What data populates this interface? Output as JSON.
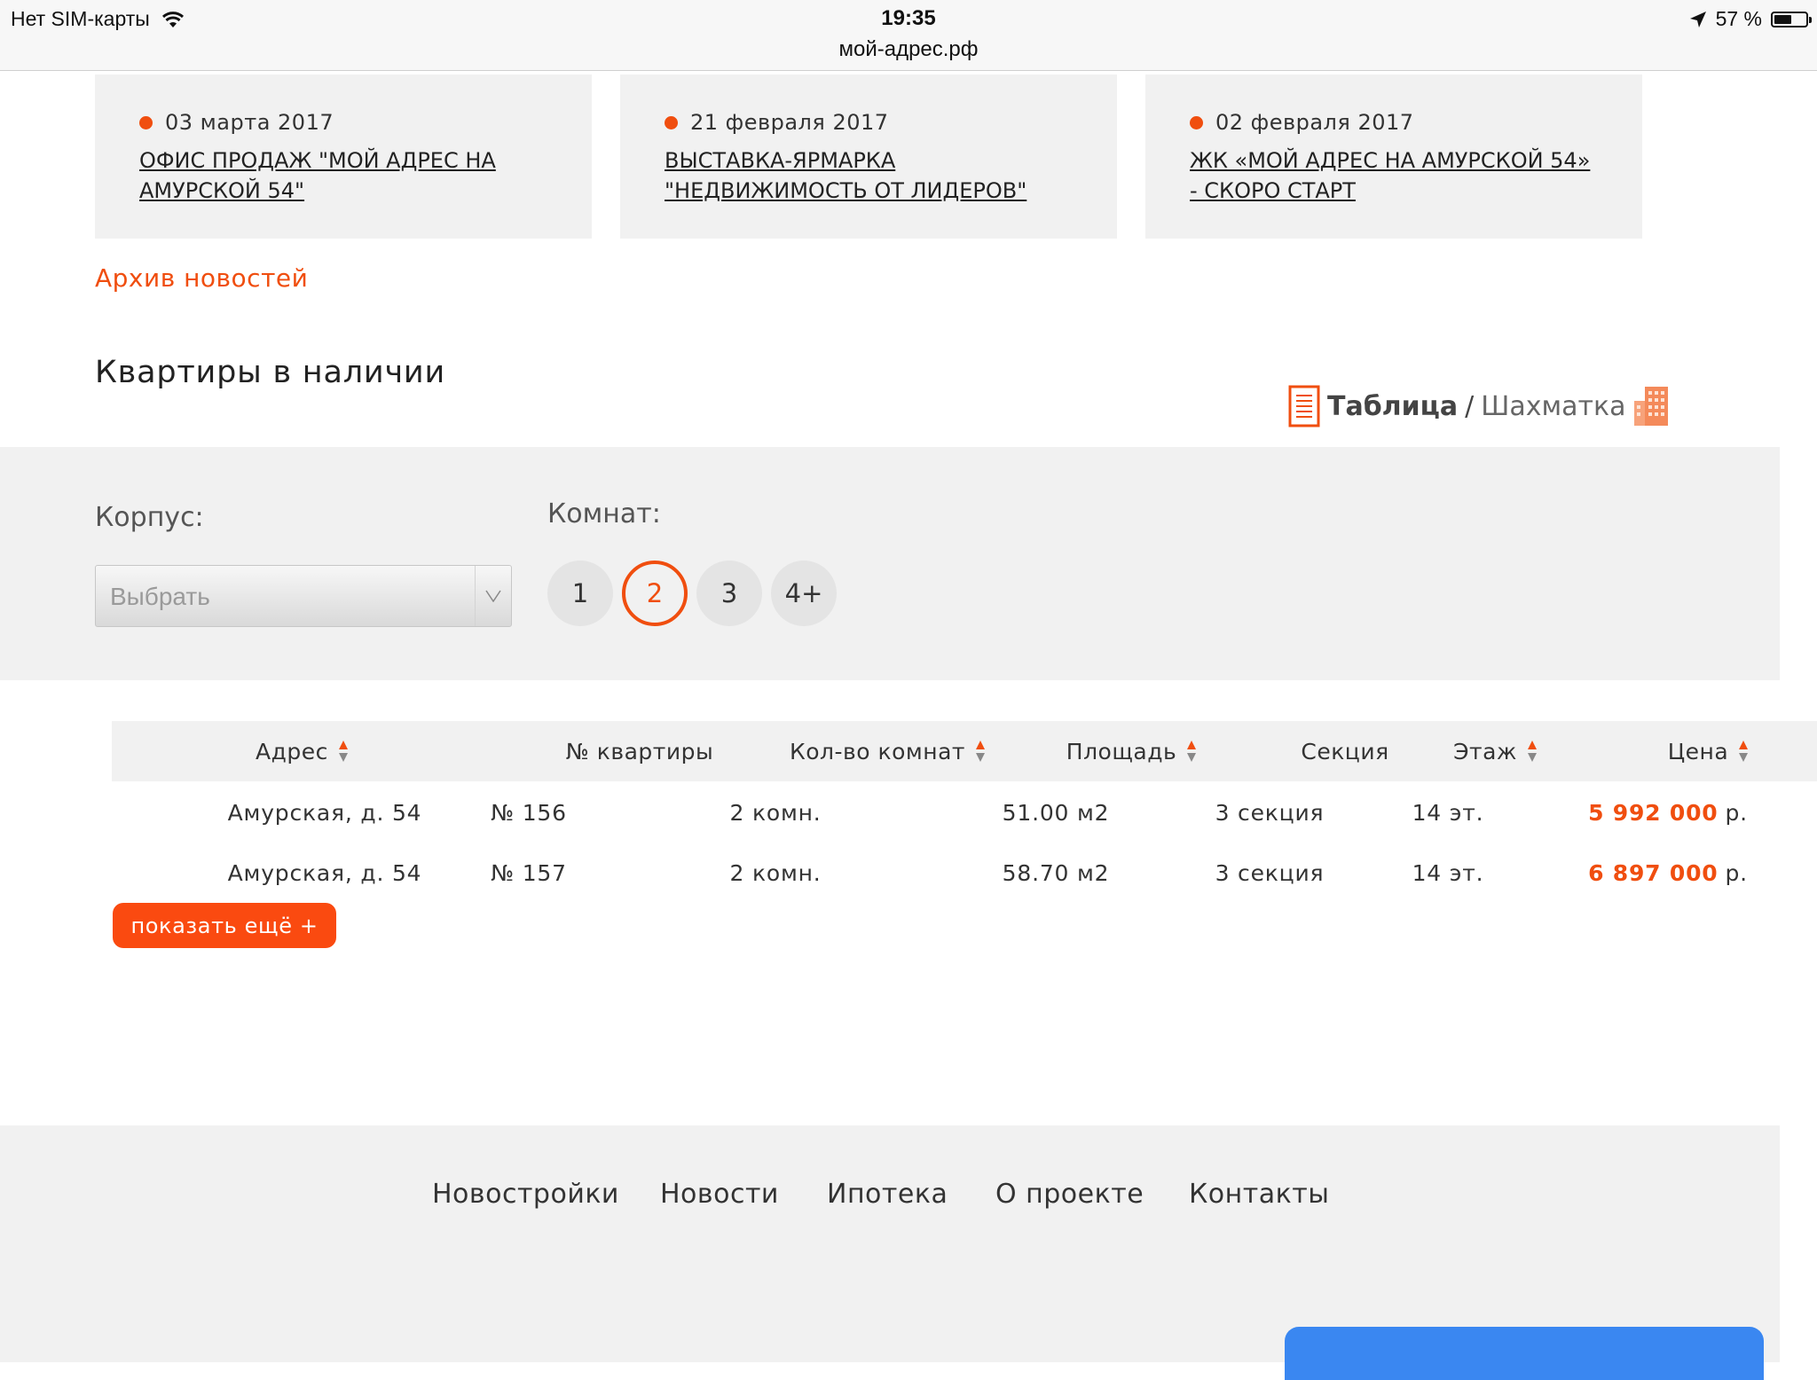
{
  "status_bar": {
    "carrier": "Нет SIM-карты",
    "time": "19:35",
    "url": "мой-адрес.рф",
    "battery_text": "57 %",
    "battery_level": 0.57
  },
  "news": [
    {
      "date": "03 марта 2017",
      "title_line1": "ОФИС ПРОДАЖ \"МОЙ АДРЕС НА",
      "title_line2": "АМУРСКОЙ 54\""
    },
    {
      "date": "21 февраля 2017",
      "title_line1": "ВЫСТАВКА-ЯРМАРКА",
      "title_line2": "\"НЕДВИЖИМОСТЬ ОТ ЛИДЕРОВ\""
    },
    {
      "date": "02 февраля 2017",
      "title_line1": "ЖК «МОЙ АДРЕС НА АМУРСКОЙ 54»",
      "title_line2": "- СКОРО СТАРТ"
    }
  ],
  "archive_link": "Архив новостей",
  "section_title": "Квартиры в наличии",
  "view_toggle": {
    "table": "Таблица",
    "separator": "/",
    "chess": "Шахматка"
  },
  "filters": {
    "korpus_label": "Корпус:",
    "korpus_value": "Выбрать",
    "rooms_label": "Комнат:",
    "rooms": [
      "1",
      "2",
      "3",
      "4+"
    ],
    "rooms_selected": "2"
  },
  "table": {
    "columns": [
      "Адрес",
      "№ квартиры",
      "Кол-во комнат",
      "Площадь",
      "Секция",
      "Этаж",
      "Цена"
    ],
    "rows": [
      {
        "address": "Амурская, д. 54",
        "number": "№ 156",
        "rooms": "2 комн.",
        "area": "51.00 м2",
        "section": "3 секция",
        "floor": "14 эт.",
        "price": "5 992 000",
        "currency": "р."
      },
      {
        "address": "Амурская, д. 54",
        "number": "№ 157",
        "rooms": "2 комн.",
        "area": "58.70 м2",
        "section": "3 секция",
        "floor": "14 эт.",
        "price": "6 897 000",
        "currency": "р."
      }
    ]
  },
  "show_more": "показать ещё +",
  "footer_nav": [
    "Новостройки",
    "Новости",
    "Ипотека",
    "О проекте",
    "Контакты"
  ],
  "colors": {
    "accent": "#f04e0f",
    "panel": "#f1f1f1",
    "blue": "#3a87f1"
  }
}
